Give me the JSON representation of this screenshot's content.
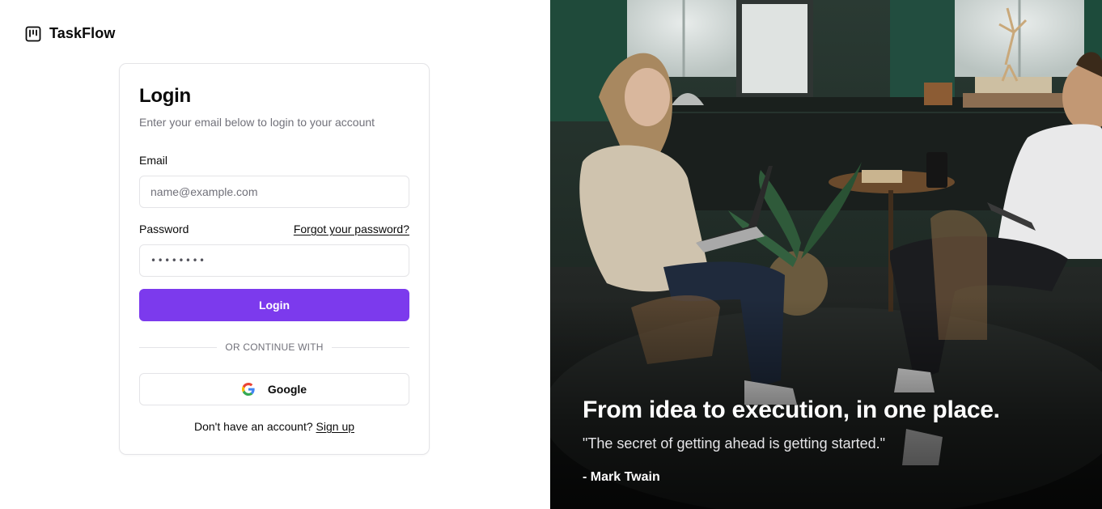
{
  "brand": {
    "name": "TaskFlow",
    "icon": "kanban-board-icon"
  },
  "login_card": {
    "title": "Login",
    "subtitle": "Enter your email below to login to your account",
    "email_label": "Email",
    "email_placeholder": "name@example.com",
    "password_label": "Password",
    "forgot_password": "Forgot your password?",
    "password_value": "••••••••",
    "login_button": "Login",
    "divider_text": "OR CONTINUE WITH",
    "google_button": "Google",
    "google_icon": "google-g-icon",
    "signup_prompt": "Don't have an account?",
    "signup_link": "Sign up"
  },
  "hero": {
    "heading": "From idea to execution, in one place.",
    "quote": "\"The secret of getting ahead is getting started.\"",
    "author": "- Mark Twain"
  },
  "colors": {
    "primary": "#7c3aed",
    "border": "#e4e4e7",
    "muted_text": "#71717a",
    "text": "#0a0a0a"
  }
}
